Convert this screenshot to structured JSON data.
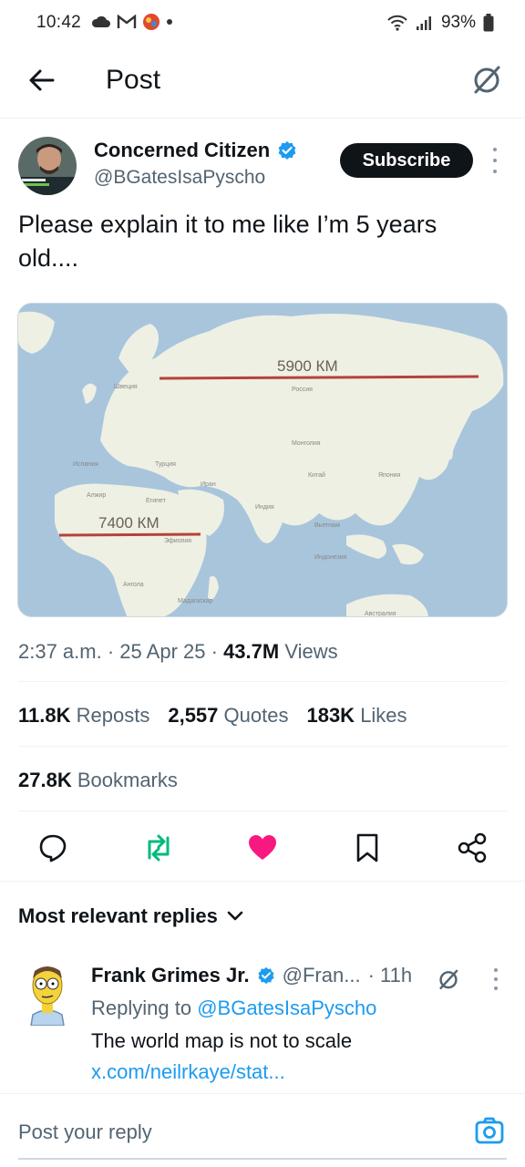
{
  "status_bar": {
    "time": "10:42",
    "battery": "93%"
  },
  "header": {
    "title": "Post"
  },
  "author": {
    "name": "Concerned Citizen",
    "handle": "@BGatesIsaPyscho",
    "subscribe_label": "Subscribe"
  },
  "post": {
    "text": "Please explain it to me like I’m 5 years old....",
    "map_labels": {
      "distance_russia": "5900 КМ",
      "distance_africa": "7400 КМ"
    }
  },
  "meta": {
    "time": "2:37 a.m.",
    "date": "25 Apr 25",
    "views_count": "43.7M",
    "views_label": "Views"
  },
  "stats": {
    "reposts_count": "11.8K",
    "reposts_label": "Reposts",
    "quotes_count": "2,557",
    "quotes_label": "Quotes",
    "likes_count": "183K",
    "likes_label": "Likes",
    "bookmarks_count": "27.8K",
    "bookmarks_label": "Bookmarks"
  },
  "actions": {
    "reply_icon": "reply-icon",
    "repost_icon": "repost-icon",
    "like_icon": "heart-icon",
    "bookmark_icon": "bookmark-icon",
    "share_icon": "share-icon",
    "repost_color": "#00ba7c",
    "like_color": "#f91880"
  },
  "replies": {
    "header": "Most relevant replies",
    "items": [
      {
        "name": "Frank Grimes Jr.",
        "handle": "@Fran...",
        "time": "· 11h",
        "replying_prefix": "Replying to",
        "replying_handle": "@BGatesIsaPyscho",
        "text": "The world map is not to scale",
        "link": "x.com/neilrkaye/stat..."
      }
    ]
  },
  "compose": {
    "placeholder": "Post your reply"
  },
  "colors": {
    "accent": "#1d9bf0",
    "text": "#0f1419",
    "secondary": "#536471"
  }
}
